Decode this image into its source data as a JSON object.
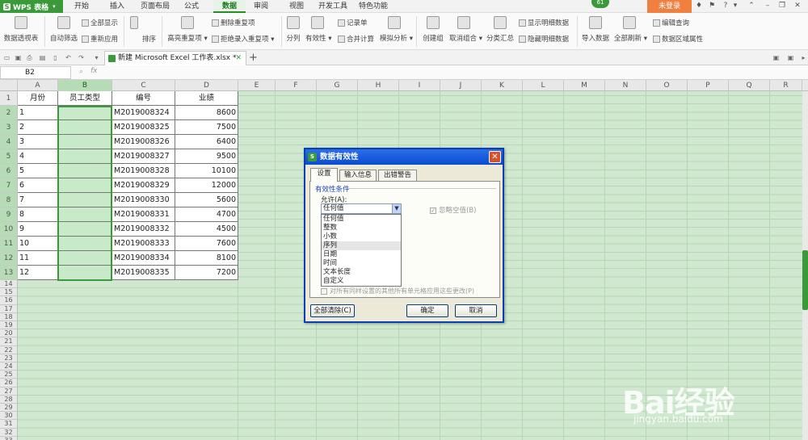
{
  "app": {
    "title": "WPS 表格",
    "badge": "61",
    "login": "未登录"
  },
  "menu_tabs": [
    "开始",
    "插入",
    "页面布局",
    "公式",
    "数据",
    "审阅",
    "视图",
    "开发工具",
    "特色功能"
  ],
  "ribbon": {
    "pivot": "数据透视表",
    "autofilter": "自动筛选",
    "show_all": "全部显示",
    "reapply": "重新应用",
    "sort": "排序",
    "highlight_dup": "高亮重复项",
    "delete_dup": "删除重复项",
    "reject_dup": "拒绝录入重复项",
    "split": "分列",
    "validity": "有效性",
    "record": "记录单",
    "merge_calc": "合并计算",
    "simulate": "模拟分析",
    "create_group": "创建组",
    "ungroup": "取消组合",
    "subtotal": "分类汇总",
    "show_detail": "显示明细数据",
    "hide_detail": "隐藏明细数据",
    "import": "导入数据",
    "refresh_all": "全部刷新",
    "edit_query": "编辑查询",
    "range_props": "数据区域属性"
  },
  "doc_tab": "新建 Microsoft Excel 工作表.xlsx *",
  "name_box": "B2",
  "fx_label": "fx",
  "columns": [
    "A",
    "B",
    "C",
    "D",
    "E",
    "F",
    "G",
    "H",
    "I",
    "J",
    "K",
    "L",
    "M",
    "N",
    "O",
    "P",
    "Q",
    "R"
  ],
  "rows": [
    "1",
    "2",
    "3",
    "4",
    "5",
    "6",
    "7",
    "8",
    "9",
    "10",
    "11",
    "12",
    "13",
    "14",
    "15",
    "16",
    "17",
    "18",
    "19",
    "20",
    "21",
    "22",
    "23",
    "24",
    "25",
    "26",
    "27",
    "28",
    "29",
    "30",
    "31",
    "32",
    "33"
  ],
  "table": {
    "headers": [
      "月份",
      "员工类型",
      "编号",
      "业绩"
    ],
    "data": [
      [
        "1",
        "",
        "M2019008324",
        "8600"
      ],
      [
        "2",
        "",
        "M2019008325",
        "7500"
      ],
      [
        "3",
        "",
        "M2019008326",
        "6400"
      ],
      [
        "4",
        "",
        "M2019008327",
        "9500"
      ],
      [
        "5",
        "",
        "M2019008328",
        "10100"
      ],
      [
        "6",
        "",
        "M2019008329",
        "12000"
      ],
      [
        "7",
        "",
        "M2019008330",
        "5600"
      ],
      [
        "8",
        "",
        "M2019008331",
        "4700"
      ],
      [
        "9",
        "",
        "M2019008332",
        "4500"
      ],
      [
        "10",
        "",
        "M2019008333",
        "7600"
      ],
      [
        "11",
        "",
        "M2019008334",
        "8100"
      ],
      [
        "12",
        "",
        "M2019008335",
        "7200"
      ]
    ]
  },
  "dialog": {
    "title": "数据有效性",
    "tabs": [
      "设置",
      "输入信息",
      "出错警告"
    ],
    "group": "有效性条件",
    "allow_label": "允许(A):",
    "allow_value": "任何值",
    "options": [
      "任何值",
      "整数",
      "小数",
      "序列",
      "日期",
      "时间",
      "文本长度",
      "自定义"
    ],
    "ignore_blank": "忽略空值(B)",
    "apply_all": "对所有同样设置的其他所有单元格应用这些更改(P)",
    "clear_all": "全部清除(C)",
    "ok": "确定",
    "cancel": "取消"
  },
  "watermark": {
    "brand": "Bai经验",
    "url": "jingyan.baidu.com"
  }
}
